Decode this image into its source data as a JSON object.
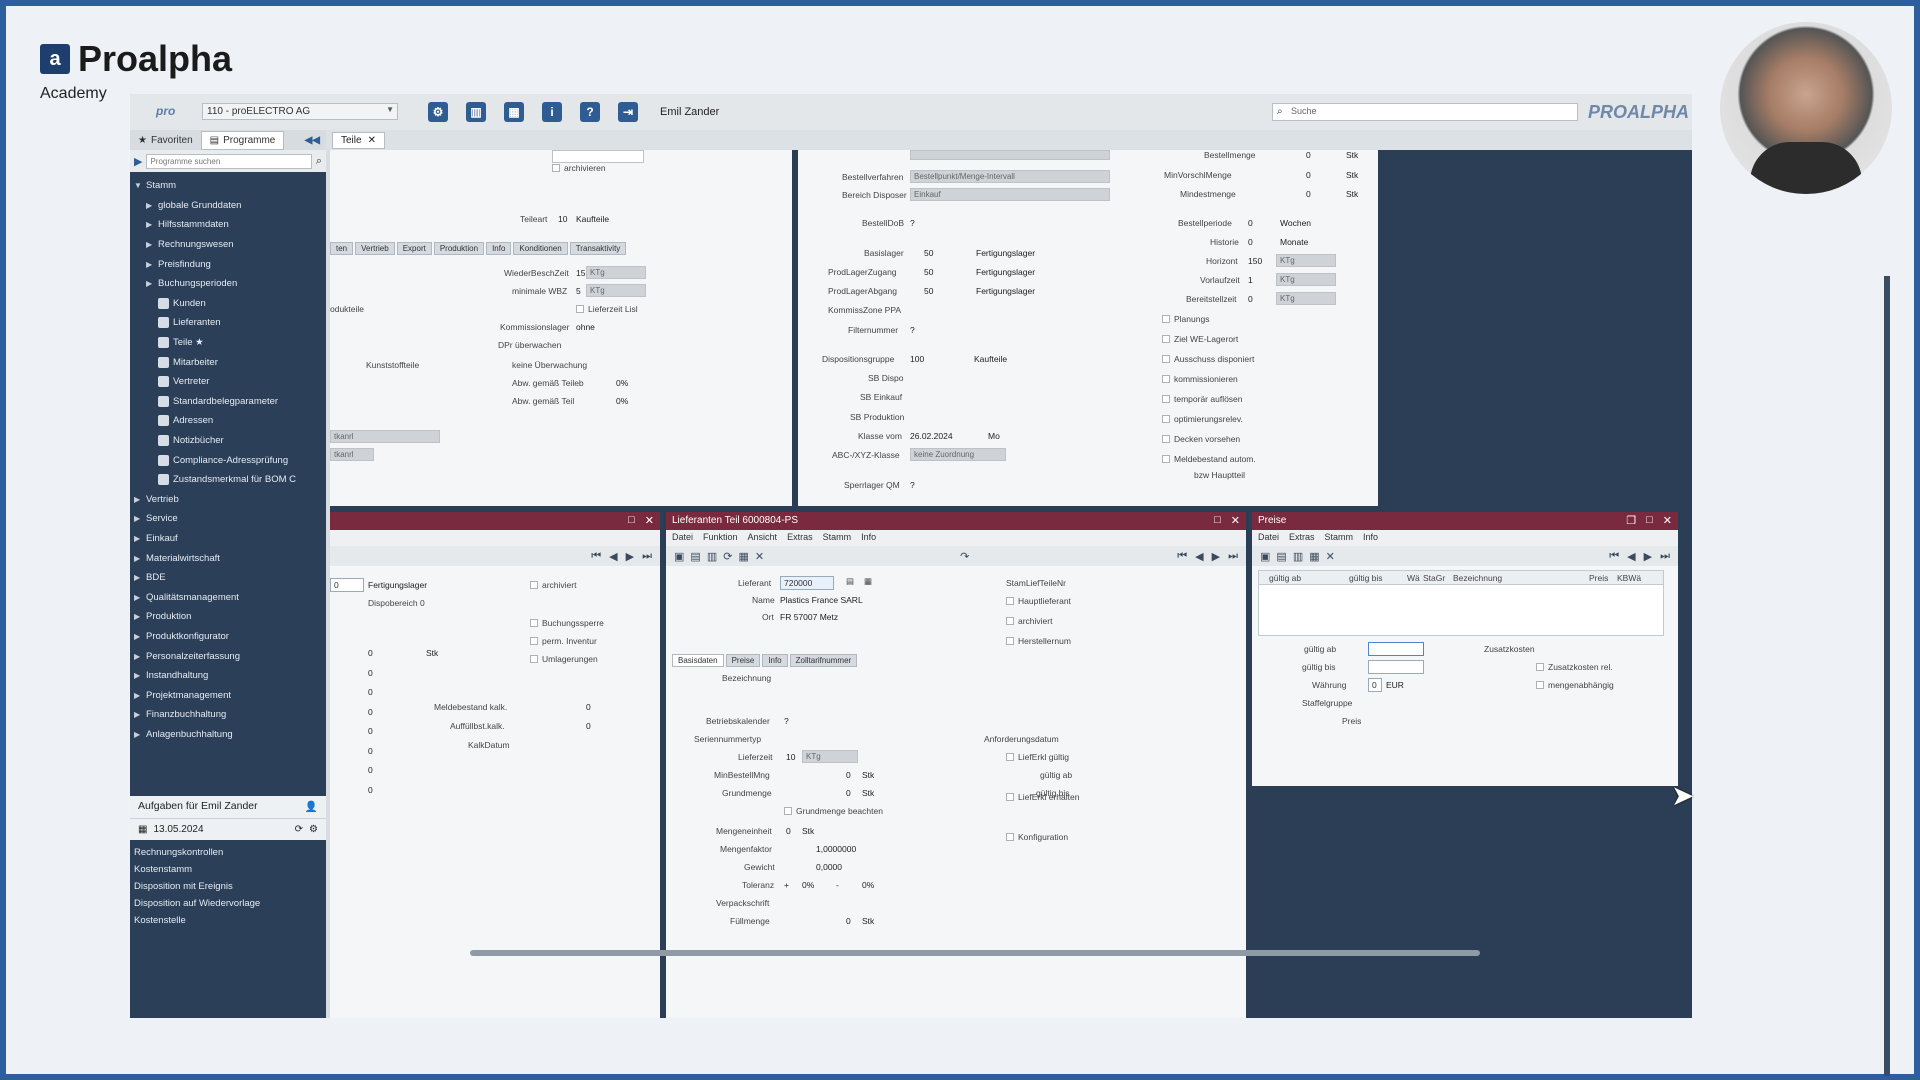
{
  "brand": {
    "name": "Proalpha",
    "sub": "Academy",
    "logo_letter": "a"
  },
  "topbar": {
    "pro_mark": "pro",
    "company": "110 - proELECTRO AG",
    "icons": [
      "gear-icon",
      "columns-icon",
      "table-icon",
      "info-icon",
      "help-icon",
      "exit-icon"
    ],
    "user": "Emil Zander",
    "search_placeholder": "Suche",
    "logo": "PROALPHA"
  },
  "nav": {
    "tabs": [
      {
        "label": "Favoriten"
      },
      {
        "label": "Programme"
      }
    ],
    "search_placeholder": "Programme suchen",
    "tree": [
      {
        "label": "Stamm",
        "level": 0,
        "open": true
      },
      {
        "label": "globale Grunddaten",
        "level": 1
      },
      {
        "label": "Hilfsstammdaten",
        "level": 1
      },
      {
        "label": "Rechnungswesen",
        "level": 1
      },
      {
        "label": "Preisfindung",
        "level": 1
      },
      {
        "label": "Buchungsperioden",
        "level": 1
      },
      {
        "label": "Kunden",
        "level": 2
      },
      {
        "label": "Lieferanten",
        "level": 2
      },
      {
        "label": "Teile ★",
        "level": 2
      },
      {
        "label": "Mitarbeiter",
        "level": 2
      },
      {
        "label": "Vertreter",
        "level": 2
      },
      {
        "label": "Standardbelegparameter",
        "level": 2
      },
      {
        "label": "Adressen",
        "level": 2
      },
      {
        "label": "Notizbücher",
        "level": 2
      },
      {
        "label": "Compliance-Adressprüfung",
        "level": 2
      },
      {
        "label": "Zustandsmerkmal für BOM C",
        "level": 2
      },
      {
        "label": "Vertrieb",
        "level": 0
      },
      {
        "label": "Service",
        "level": 0
      },
      {
        "label": "Einkauf",
        "level": 0
      },
      {
        "label": "Materialwirtschaft",
        "level": 0
      },
      {
        "label": "BDE",
        "level": 0
      },
      {
        "label": "Qualitätsmanagement",
        "level": 0
      },
      {
        "label": "Produktion",
        "level": 0
      },
      {
        "label": "Produktkonfigurator",
        "level": 0
      },
      {
        "label": "Personalzeiterfassung",
        "level": 0
      },
      {
        "label": "Instandhaltung",
        "level": 0
      },
      {
        "label": "Projektmanagement",
        "level": 0
      },
      {
        "label": "Finanzbuchhaltung",
        "level": 0
      },
      {
        "label": "Anlagenbuchhaltung",
        "level": 0
      }
    ],
    "tasks_title": "Aufgaben für Emil Zander",
    "tasks_date": "13.05.2024",
    "tasks": [
      "Rechnungskontrollen",
      "Kostenstamm",
      "Disposition mit Ereignis",
      "Disposition auf Wiedervorlage",
      "Kostenstelle"
    ]
  },
  "tabstrip": {
    "tab": "Teile"
  },
  "panel_a": {
    "archivieren": "archivieren",
    "teileart_label": "Teileart",
    "teileart_num": "10",
    "teileart_val": "Kaufteile",
    "tabs": [
      "ten",
      "Vertrieb",
      "Export",
      "Produktion",
      "Info",
      "Konditionen",
      "Transaktivity"
    ],
    "wbz_label": "WiederBeschZeit",
    "wbz_val": "15",
    "wbz_unit": "KTg",
    "mwbz_label": "minimale WBZ",
    "mwbz_val": "5",
    "mwbz_unit": "KTg",
    "produktfeld": "odukteile",
    "lieferzeit": "Lieferzeit Lisl",
    "kommission_label": "Kommissionslager",
    "kommission_val": "ohne",
    "dpr": "DPr überwachen",
    "kunststoff": "Kunststoffteile",
    "keine": "keine Überwachung",
    "abw1": "Abw. gemäß Teileb",
    "abw1_pct": "0%",
    "abw2": "Abw. gemäß Teil",
    "abw2_pct": "0%",
    "grey1": "tkanrl",
    "grey2": "tkanrl"
  },
  "panel_b": {
    "rows_left": [
      {
        "label": "Bestellverfahren",
        "box": "Bestellpunkt/Menge-Intervall"
      },
      {
        "label": "Bereich Disposer",
        "box": "Einkauf"
      }
    ],
    "bestelldos_label": "BestellDoB",
    "bestelldos_val": "?",
    "lager": [
      {
        "label": "Basislager",
        "num": "50",
        "val": "Fertigungslager"
      },
      {
        "label": "ProdLagerZugang",
        "num": "50",
        "val": "Fertigungslager"
      },
      {
        "label": "ProdLagerAbgang",
        "num": "50",
        "val": "Fertigungslager"
      }
    ],
    "kommzone": "KommissZone PPA",
    "filternummer": "Filternummer",
    "filter_val": "?",
    "dispgruppe_label": "Dispositionsgruppe",
    "dispgruppe_num": "100",
    "dispgruppe_val": "Kaufteile",
    "sb": [
      "SB Dispo",
      "SB Einkauf",
      "SB Produktion"
    ],
    "klasse_label": "Klasse vom",
    "klasse_date": "26.02.2024",
    "klasse_unit": "Mo",
    "abc_label": "ABC-/XYZ-Klasse",
    "abc_box": "keine Zuordnung",
    "sperrlager_label": "Sperrlager QM",
    "sperrlager_val": "?",
    "right": [
      {
        "label": "Bestellmenge",
        "num": "0",
        "unit": "Stk"
      },
      {
        "label": "MinVorschlMenge",
        "num": "0",
        "unit": "Stk"
      },
      {
        "label": "Mindestmenge",
        "num": "0",
        "unit": "Stk"
      }
    ],
    "periode_label": "Bestellperiode",
    "periode_num": "0",
    "periode_unit": "Wochen",
    "historie_label": "Historie",
    "historie_num": "0",
    "historie_unit": "Monate",
    "horizont_label": "Horizont",
    "horizont_num": "150",
    "horizont_unit": "KTg",
    "vorlauf_label": "Vorlaufzeit",
    "vorlauf_num": "1",
    "vorlauf_unit": "KTg",
    "bereit_label": "Bereitstellzeit",
    "bereit_num": "0",
    "bereit_unit": "KTg",
    "checks": [
      "Planungs",
      "Ziel WE-Lagerort",
      "Ausschuss disponiert",
      "kommissionieren",
      "temporär auflösen",
      "optimierungsrelev.",
      "Decken vorsehen",
      "Meldebestand autom."
    ],
    "hauptteil": "bzw Hauptteil"
  },
  "panel_c": {
    "lager_num": "0",
    "lager_val": "Fertigungslager",
    "dispobereich": "Dispobereich 0",
    "archiviert": "archiviert",
    "buchungssperre": "Buchungssperre",
    "perm_inventur": "perm. Inventur",
    "umlagerungen": "Umlagerungen",
    "stk": "Stk",
    "meldebestand": "Meldebestand kalk.",
    "meldebestand_val": "0",
    "auffuell": "Auffüllbst.kalk.",
    "auffuell_val": "0",
    "kalkdatum": "KalkDatum",
    "zeros": [
      "0",
      "0",
      "0",
      "0",
      "0",
      "0",
      "0",
      "0"
    ]
  },
  "panel_d": {
    "title": "Lieferanten Teil 6000804-PS",
    "menu": [
      "Datei",
      "Funktion",
      "Ansicht",
      "Extras",
      "Stamm",
      "Info"
    ],
    "lieferant_label": "Lieferant",
    "lieferant_val": "720000",
    "name_label": "Name",
    "name_val": "Plastics France SARL",
    "ort_label": "Ort",
    "ort_val": "FR 57007 Metz",
    "stamm": "StamLiefTeileNr",
    "checks": [
      "Hauptlieferant",
      "archiviert",
      "Herstellernum"
    ],
    "tabs": [
      "Basisdaten",
      "Preise",
      "Info",
      "Zolltarifnummer"
    ],
    "bezeichnung": "Bezeichnung",
    "betriebskalender": "Betriebskalender",
    "bk_val": "?",
    "seriennummer": "Seriennummertyp",
    "lieferzeit_label": "Lieferzeit",
    "lieferzeit_val": "10",
    "lieferzeit_unit": "KTg",
    "minbest_label": "MinBestellMng",
    "minbest_val": "0",
    "minbest_unit": "Stk",
    "grund_label": "Grundmenge",
    "grund_val": "0",
    "grund_unit": "Stk",
    "grund_chk": "Grundmenge beachten",
    "mengeneinheit": "Mengeneinheit",
    "me_val": "0",
    "me_unit": "Stk",
    "faktor_label": "Mengenfaktor",
    "faktor_val": "1,0000000",
    "gewicht_label": "Gewicht",
    "gewicht_val": "0,0000",
    "toleranz_label": "Toleranz",
    "tol_plus": "+",
    "tol1": "0%",
    "tol_minus": "-",
    "tol2": "0%",
    "verpack": "Verpackschrift",
    "fuell_label": "Füllmenge",
    "fuell_val": "0",
    "fuell_unit": "Stk",
    "right_checks": [
      "LiefErkl gültig",
      "LiefErkl erhalten",
      "Konfiguration"
    ],
    "anforderung": "Anforderungsdatum",
    "gueltig_ab": "gültig ab",
    "gueltig_bis": "gültig bis"
  },
  "panel_e": {
    "title": "Preise",
    "menu": [
      "Datei",
      "Extras",
      "Stamm",
      "Info"
    ],
    "cols": [
      "gültig ab",
      "gültig bis",
      "Wä",
      "StaGr",
      "Bezeichnung",
      "Preis",
      "KBWä"
    ],
    "zusatzkosten": "Zusatzkosten",
    "gueltig_ab": "gültig ab",
    "gueltig_bis": "gültig bis",
    "waehrung_label": "Währung",
    "waehrung_num": "0",
    "waehrung_val": "EUR",
    "staffelgruppe": "Staffelgruppe",
    "preis": "Preis",
    "checks": [
      "Zusatzkosten rel.",
      "mengenabhängig"
    ]
  }
}
